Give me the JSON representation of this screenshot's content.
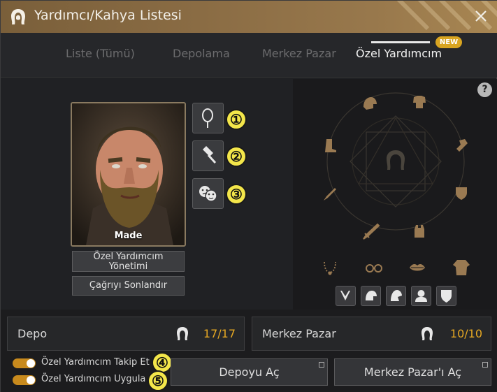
{
  "window": {
    "title": "Yardımcı/Kahya Listesi"
  },
  "tabs": [
    {
      "label": "Liste (Tümü)",
      "active": false
    },
    {
      "label": "Depolama",
      "active": false
    },
    {
      "label": "Merkez Pazar",
      "active": false
    },
    {
      "label": "Özel Yardımcım",
      "active": true
    }
  ],
  "new_badge": "NEW",
  "portrait": {
    "name": "Made"
  },
  "side_buttons": [
    {
      "icon": "mirror-icon",
      "badge": "①"
    },
    {
      "icon": "hammer-icon",
      "badge": "②"
    },
    {
      "icon": "emotion-masks-icon",
      "badge": "③"
    }
  ],
  "manage_button": "Özel Yardımcım Yönetimi",
  "end_call_button": "Çağrıyı Sonlandır",
  "help": "?",
  "equipment_slots": [
    "helmet-icon",
    "chest-armor-icon",
    "gloves-icon",
    "boots-icon",
    "shield-icon",
    "dagger-icon",
    "sword-icon",
    "vest-icon",
    "necklace-icon",
    "glasses-icon",
    "lips-icon",
    "outfit-icon"
  ],
  "small_slots": [
    "costume-a-icon",
    "costume-b-icon",
    "costume-c-icon",
    "costume-d-icon",
    "costume-e-icon"
  ],
  "depo": {
    "label": "Depo",
    "value": "17/17"
  },
  "market": {
    "label": "Merkez Pazar",
    "value": "10/10"
  },
  "toggles": [
    {
      "label": "Özel Yardımcım Takip Et",
      "badge": "④",
      "on": true
    },
    {
      "label": "Özel Yardımcım Uygula",
      "badge": "⑤",
      "on": true
    }
  ],
  "open_depot_button": "Depoyu Aç",
  "open_market_button": "Merkez Pazar'ı Aç",
  "colors": {
    "accent": "#e6a823",
    "header": "#8a6c44",
    "badge": "#f3e64a"
  }
}
